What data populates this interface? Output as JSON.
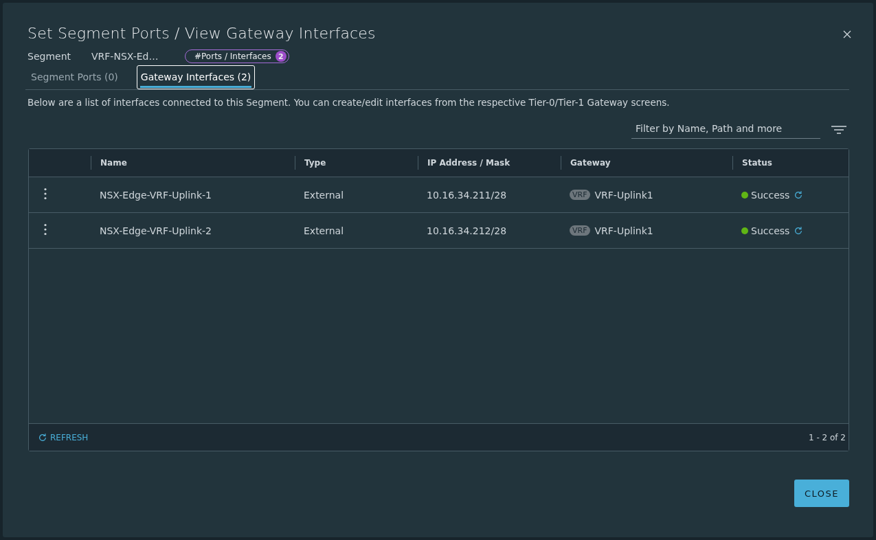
{
  "dialog": {
    "title": "Set Segment Ports / View Gateway Interfaces"
  },
  "segment": {
    "label": "Segment",
    "value": "VRF-NSX-Ed…"
  },
  "ports_badge": {
    "label": "#Ports / Interfaces",
    "count": "2"
  },
  "tabs": [
    {
      "label": "Segment Ports (0)",
      "selected": false
    },
    {
      "label": "Gateway Interfaces (2)",
      "selected": true
    }
  ],
  "description": "Below are a list of interfaces connected to this Segment. You can create/edit interfaces from the respective Tier-0/Tier-1 Gateway screens.",
  "filter": {
    "placeholder": "Filter by Name, Path and more"
  },
  "table": {
    "columns": [
      "Name",
      "Type",
      "IP Address / Mask",
      "Gateway",
      "Status"
    ],
    "rows": [
      {
        "name": "NSX-Edge-VRF-Uplink-1",
        "type": "External",
        "ip": "10.16.34.211/28",
        "gateway_tag": "VRF",
        "gateway": "VRF-Uplink1",
        "status": "Success"
      },
      {
        "name": "NSX-Edge-VRF-Uplink-2",
        "type": "External",
        "ip": "10.16.34.212/28",
        "gateway_tag": "VRF",
        "gateway": "VRF-Uplink1",
        "status": "Success"
      }
    ]
  },
  "footer": {
    "refresh": "REFRESH",
    "pagination": "1 - 2 of 2"
  },
  "buttons": [
    "CLOSE"
  ]
}
